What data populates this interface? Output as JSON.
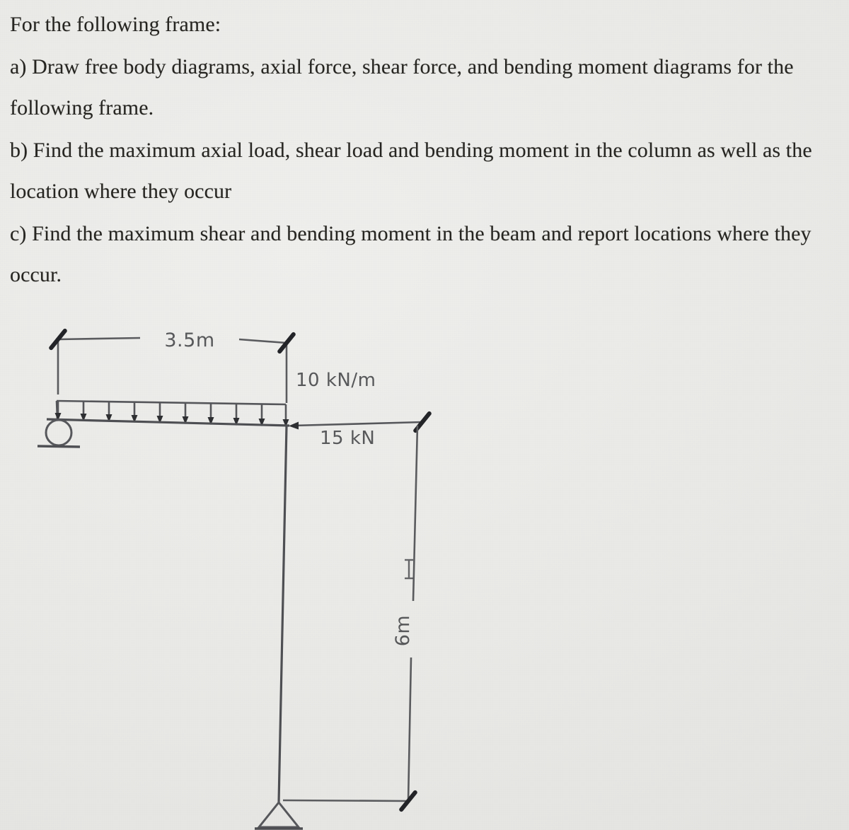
{
  "document": {
    "type": "scanned-textbook-problem",
    "prompt": "For the following frame:",
    "questions": [
      "a) Draw free body diagrams, axial force, shear force, and bending moment diagrams for the following frame.",
      "b) Find the maximum axial load, shear load and bending moment in the column as well as the location where they occur",
      "c) Find the maximum shear and bending moment in the beam and report locations where they occur."
    ]
  },
  "question_lines": {
    "prompt": "For the following frame:",
    "a1": "a) Draw free body diagrams, axial force, shear force, and bending moment diagrams for the",
    "a2": "following frame.",
    "b1": "b) Find the maximum axial load, shear load and bending moment in the column as well as the",
    "b2": "location where they occur",
    "c1": "c) Find the maximum shear and bending moment in the beam and report locations where they",
    "c2": "occur."
  },
  "diagram": {
    "title": "frame-free-body-diagram",
    "dimensions": {
      "beam_span": "3.5m",
      "column_height": "6m"
    },
    "loads": {
      "distributed": "10 kN/m",
      "point": "15 kN"
    },
    "supports": {
      "left": "roller",
      "bottom": "pin"
    },
    "colors": {
      "ink": "#54565a",
      "dark_ink": "#2f3033",
      "paper": "#e9e9e6"
    },
    "distributed_load_arrow_count": 10
  }
}
